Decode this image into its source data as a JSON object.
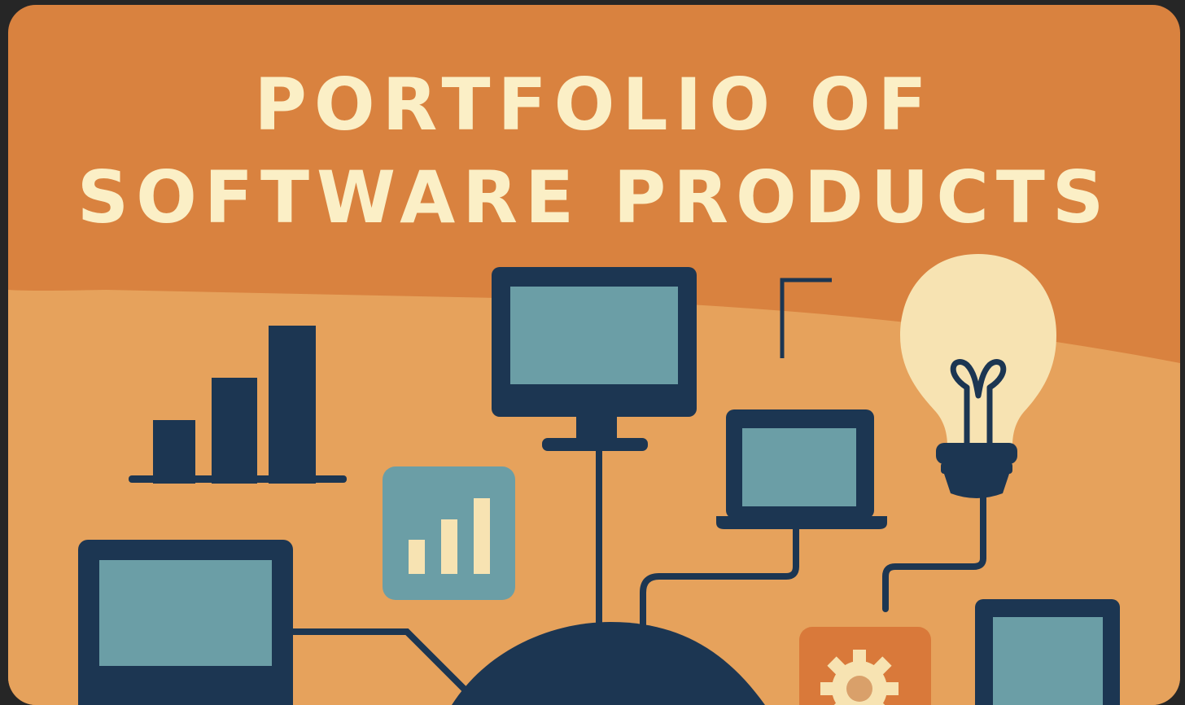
{
  "poster": {
    "title_line1": "PORTFOLIO OF",
    "title_line2": "SOFTWARE PRODUCTS"
  },
  "colors": {
    "background_top": "#d9823f",
    "background_bottom": "#e6a25c",
    "title_text": "#fbefc6",
    "navy": "#1c3652",
    "screen_blue": "#6b9ea6",
    "bulb_cream": "#f7e3b2",
    "gear_orange": "#d9793a"
  },
  "icons": [
    "bar-chart-icon",
    "desktop-monitor-icon",
    "laptop-icon",
    "light-bulb-icon",
    "analytics-app-icon",
    "tablet-icon",
    "gear-app-icon",
    "hub-node-icon",
    "corner-bracket-icon"
  ]
}
